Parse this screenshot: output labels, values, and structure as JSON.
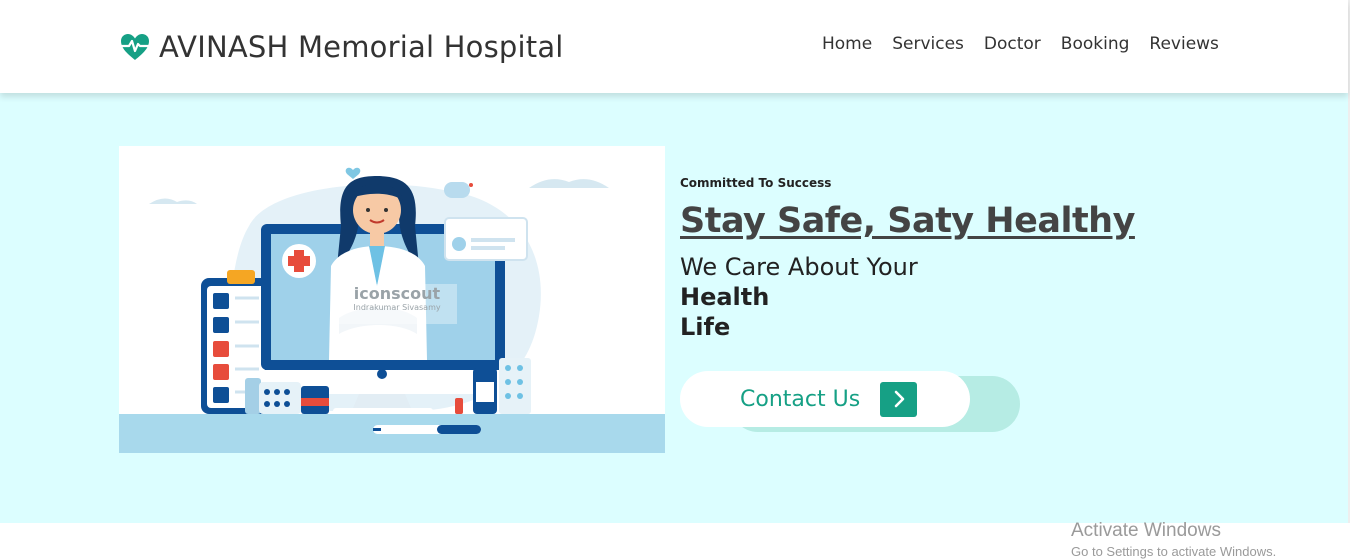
{
  "header": {
    "logo_text": "AVINASH Memorial Hospital",
    "logo_icon": "heartbeat-icon",
    "nav": [
      {
        "label": "Home"
      },
      {
        "label": "Services"
      },
      {
        "label": "Doctor"
      },
      {
        "label": "Booking"
      },
      {
        "label": "Reviews"
      }
    ]
  },
  "hero": {
    "subtitle": "Committed To Success",
    "title": "Stay Safe, Saty Healthy",
    "desc_line1": "We Care About Your",
    "desc_line2": "Health",
    "desc_line3": "Life",
    "cta_label": "Contact Us",
    "cta_icon": "chevron-right-icon",
    "image": {
      "watermark_brand": "iconscout",
      "watermark_author": "Indrakumar Sivasamy"
    }
  },
  "os_watermark": {
    "line1": "Activate Windows",
    "line2": "Go to Settings to activate Windows."
  },
  "colors": {
    "accent": "#16a085",
    "hero_bg": "#dcfeff",
    "cta_shadow": "#b6ece4"
  }
}
